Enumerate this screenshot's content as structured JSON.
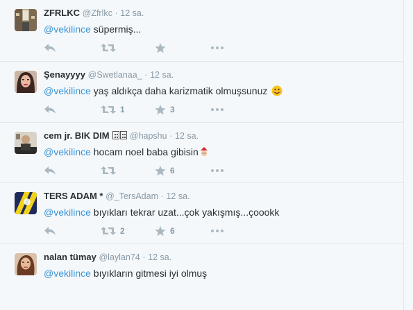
{
  "tweets": [
    {
      "name": "ZFRLKC",
      "handle": "@Zfrlkc",
      "sep": "·",
      "time": "12 sa.",
      "mention": "@vekilince",
      "text": " süpermiş...",
      "retweets": "",
      "favorites": ""
    },
    {
      "name": "Şenayyyy",
      "handle": "@Swetlanaa_",
      "sep": "·",
      "time": "12 sa.",
      "mention": "@vekilince",
      "text": " yaş aldıkça daha karizmatik olmuşsunuz ",
      "retweets": "1",
      "favorites": "3"
    },
    {
      "name": "cem jr. BIK DIM ",
      "handle": "@hapshu",
      "sep": "·",
      "time": "12 sa.",
      "mention": "@vekilince",
      "text": " hocam noel baba gibisin",
      "retweets": "",
      "favorites": "6"
    },
    {
      "name": "TERS ADAM *",
      "handle": "@_TersAdam",
      "sep": "·",
      "time": "12 sa.",
      "mention": "@vekilince",
      "text": " bıyıkları tekrar uzat...çok yakışmış...çoookk",
      "retweets": "2",
      "favorites": "6"
    },
    {
      "name": "nalan tümay",
      "handle": "@laylan74",
      "sep": "·",
      "time": "12 sa.",
      "mention": "@vekilince",
      "text": " bıyıkların gitmesi iyi olmuş",
      "retweets": "",
      "favorites": ""
    }
  ],
  "icons": {
    "reply": "reply-icon",
    "retweet": "retweet-icon",
    "favorite": "star-icon",
    "more": "more-dots-icon"
  },
  "colors": {
    "link": "#3b94d9",
    "action": "#aab8c2",
    "text": "#292f33",
    "muted": "#8899a6"
  }
}
